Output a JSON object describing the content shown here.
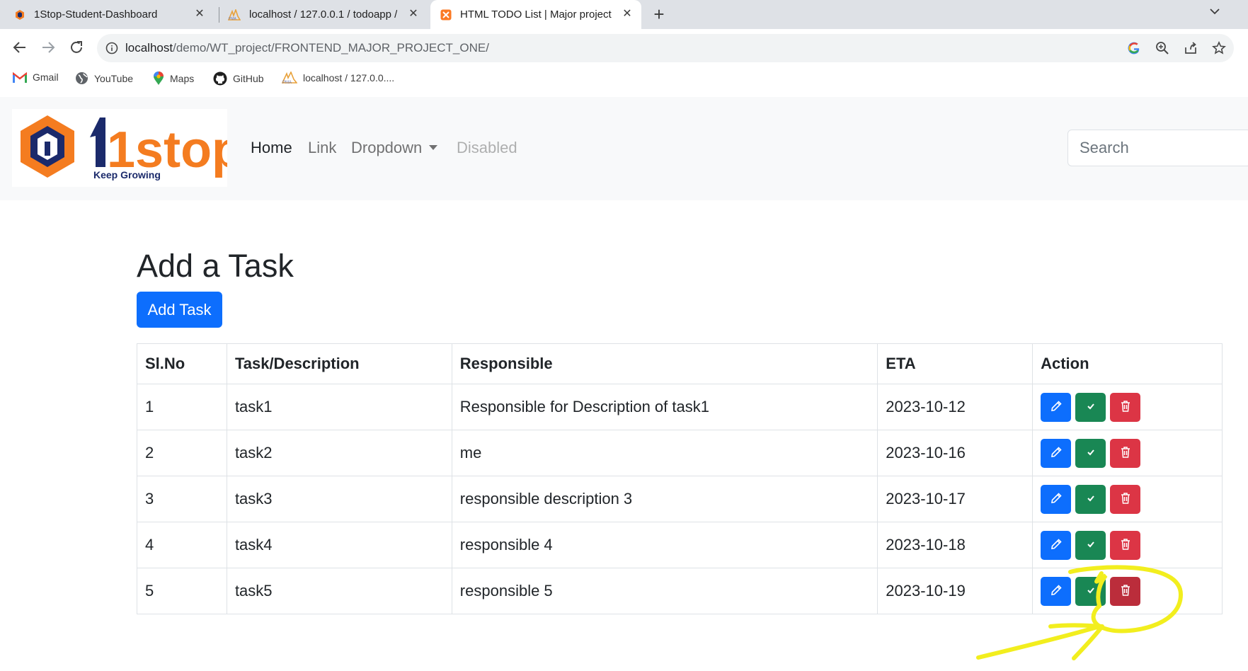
{
  "browser": {
    "tabs": [
      {
        "title": "1Stop-Student-Dashboard",
        "active": false
      },
      {
        "title": "localhost / 127.0.0.1 / todoapp / ",
        "active": false
      },
      {
        "title": "HTML TODO List | Major project",
        "active": true
      }
    ],
    "address": {
      "host": "localhost",
      "path": "/demo/WT_project/FRONTEND_MAJOR_PROJECT_ONE/"
    },
    "bookmarks": [
      {
        "label": "Gmail",
        "icon": "gmail-icon"
      },
      {
        "label": "YouTube",
        "icon": "globe-icon"
      },
      {
        "label": "Maps",
        "icon": "maps-pin-icon"
      },
      {
        "label": "GitHub",
        "icon": "github-icon"
      },
      {
        "label": "localhost / 127.0.0....",
        "icon": "phpmyadmin-icon"
      }
    ]
  },
  "navbar": {
    "logo": {
      "brand": "1stop",
      "tagline": "Keep Growing"
    },
    "links": [
      "Home",
      "Link",
      "Dropdown",
      "Disabled"
    ],
    "search_placeholder": "Search"
  },
  "main": {
    "title": "Add a Task",
    "add_button": "Add Task",
    "table": {
      "headers": [
        "Sl.No",
        "Task/Description",
        "Responsible",
        "ETA",
        "Action"
      ],
      "rows": [
        {
          "no": "1",
          "task": "task1",
          "responsible": "Responsible for Description of task1",
          "eta": "2023-10-12"
        },
        {
          "no": "2",
          "task": "task2",
          "responsible": "me",
          "eta": "2023-10-16"
        },
        {
          "no": "3",
          "task": "task3",
          "responsible": "responsible description 3",
          "eta": "2023-10-17"
        },
        {
          "no": "4",
          "task": "task4",
          "responsible": "responsible 4",
          "eta": "2023-10-18"
        },
        {
          "no": "5",
          "task": "task5",
          "responsible": "responsible 5",
          "eta": "2023-10-19"
        }
      ]
    }
  },
  "colors": {
    "primary": "#0d6efd",
    "success": "#198754",
    "danger": "#dc3545",
    "logo_orange": "#f47c20",
    "logo_navy": "#1b2a6b",
    "annotation_yellow": "#f2ee1e"
  }
}
